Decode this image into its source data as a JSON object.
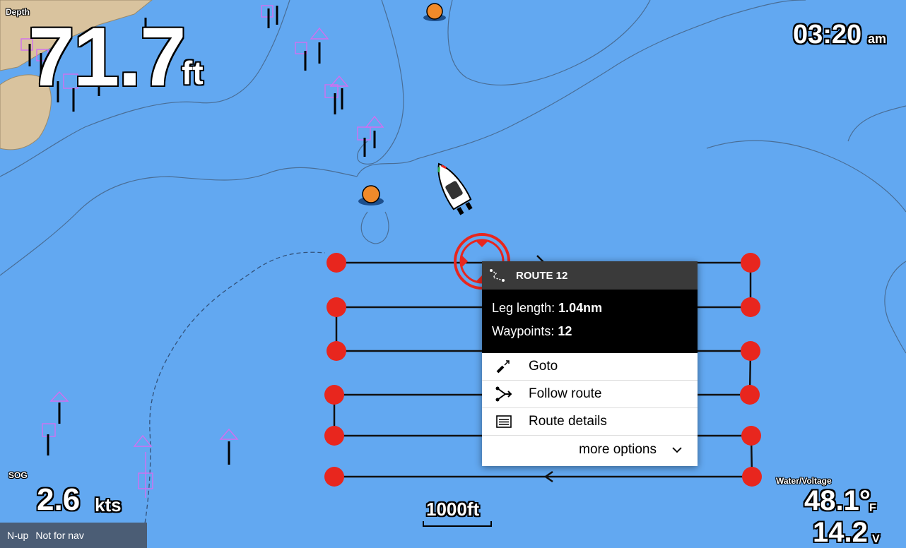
{
  "depth": {
    "label": "Depth",
    "value": "71.7",
    "unit": "ft"
  },
  "clock": {
    "time": "03:20",
    "ampm": "am"
  },
  "sog": {
    "label": "SOG",
    "value": "2.6",
    "unit": "kts"
  },
  "water_voltage": {
    "label": "Water/Voltage",
    "temperature": "48.1°",
    "temperature_unit": "F",
    "voltage": "14.2",
    "voltage_unit": "V"
  },
  "scale": {
    "label": "1000ft"
  },
  "status_bar": {
    "orientation": "N-up",
    "notice": "Not for nav"
  },
  "route_popup": {
    "title": "ROUTE 12",
    "leg_length_label": "Leg length:",
    "leg_length_value": "1.04nm",
    "waypoints_label": "Waypoints:",
    "waypoints_value": "12",
    "menu": [
      {
        "label": "Goto",
        "icon": "goto-icon"
      },
      {
        "label": "Follow route",
        "icon": "follow-route-icon"
      },
      {
        "label": "Route details",
        "icon": "route-details-icon"
      }
    ],
    "more_options": "more options"
  },
  "colors": {
    "water": "#62a8f1",
    "land": "#d9c39e",
    "waypoint": "#e8261e",
    "popup_header": "#3a3a3a",
    "status_bar": "#4b5d75"
  }
}
